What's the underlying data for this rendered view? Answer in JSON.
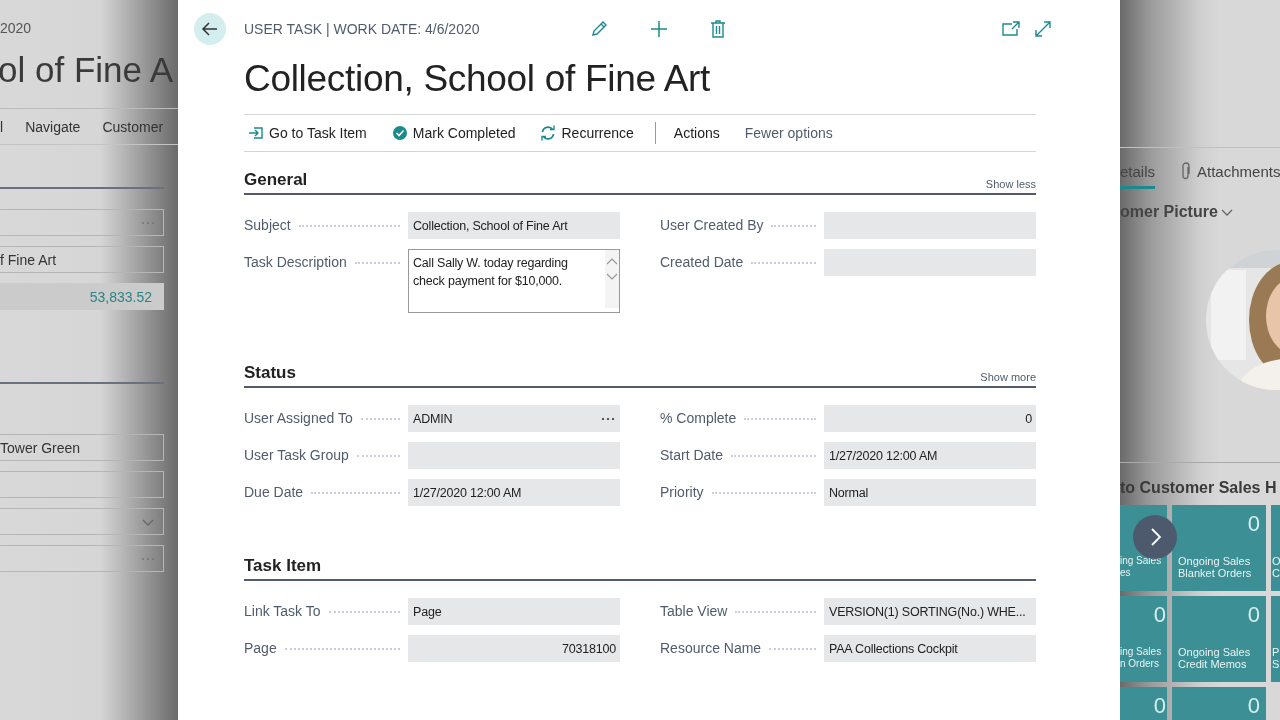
{
  "background_left": {
    "caption": "2020",
    "title": "ol of Fine A",
    "menu": [
      "l",
      "Navigate",
      "Customer"
    ],
    "groups": [
      [
        {
          "kind": "lookup"
        },
        {
          "kind": "text",
          "value": "f Fine Art"
        },
        {
          "kind": "amount",
          "value": "53,833.52"
        }
      ],
      [
        {
          "kind": "text",
          "value": "Tower Green"
        },
        {
          "kind": "text"
        },
        {
          "kind": "dropdown"
        },
        {
          "kind": "lookup"
        }
      ]
    ]
  },
  "dialog": {
    "caption": "USER TASK | WORK DATE: 4/6/2020",
    "title": "Collection, School of Fine Art",
    "promoted_actions": [
      {
        "kind": "goto",
        "label": "Go to Task Item"
      },
      {
        "kind": "complete",
        "label": "Mark Completed"
      },
      {
        "kind": "recurrence",
        "label": "Recurrence"
      }
    ],
    "menu_actions": [
      "Actions"
    ],
    "options_link": "Fewer options",
    "sections": [
      {
        "title": "General",
        "toggle": "Show less",
        "columns": [
          [
            {
              "label": "Subject",
              "kind": "text",
              "value": "Collection, School of Fine Art"
            },
            {
              "label": "Task Description",
              "kind": "textarea",
              "value": "Call Sally W. today regarding check payment for $10,000."
            }
          ],
          [
            {
              "label": "User Created By",
              "kind": "text"
            },
            {
              "label": "Created Date",
              "kind": "text"
            }
          ]
        ]
      },
      {
        "title": "Status",
        "toggle": "Show more",
        "columns": [
          [
            {
              "label": "User Assigned To",
              "kind": "lookup",
              "value": "ADMIN"
            },
            {
              "label": "User Task Group",
              "kind": "text"
            },
            {
              "label": "Due Date",
              "kind": "text",
              "value": "1/27/2020 12:00 AM"
            }
          ],
          [
            {
              "label": "% Complete",
              "kind": "number",
              "value": "0"
            },
            {
              "label": "Start Date",
              "kind": "text",
              "value": "1/27/2020 12:00 AM"
            },
            {
              "label": "Priority",
              "kind": "text",
              "value": "Normal"
            }
          ]
        ]
      },
      {
        "title": "Task Item",
        "columns": [
          [
            {
              "label": "Link Task To",
              "kind": "text",
              "value": "Page"
            },
            {
              "label": "Page",
              "kind": "number",
              "value": "70318100"
            }
          ],
          [
            {
              "label": "Table View",
              "kind": "text",
              "value": "VERSION(1) SORTING(No.) WHE..."
            },
            {
              "label": "Resource Name",
              "kind": "text",
              "value": "PAA Collections Cockpit"
            }
          ]
        ]
      }
    ]
  },
  "background_right": {
    "tabs": [
      {
        "label": "etails",
        "selected": true
      },
      {
        "label": "Attachments",
        "selected": false
      }
    ],
    "factbox_title": "omer Picture",
    "cues_title": "to Customer Sales H",
    "tile_rows": [
      [
        {
          "label": "ing Sales\nes"
        },
        {
          "count": "0",
          "label": "Ongoing Sales\nBlanket Orders"
        },
        {
          "label": "O\nC"
        }
      ],
      [
        {
          "count": "0",
          "label": "ing Sales\nn Orders"
        },
        {
          "count": "0",
          "label": "Ongoing Sales\nCredit Memos"
        },
        {
          "label": "P\nS"
        }
      ],
      [
        {
          "count": "0"
        },
        {
          "count": "0"
        }
      ]
    ]
  }
}
